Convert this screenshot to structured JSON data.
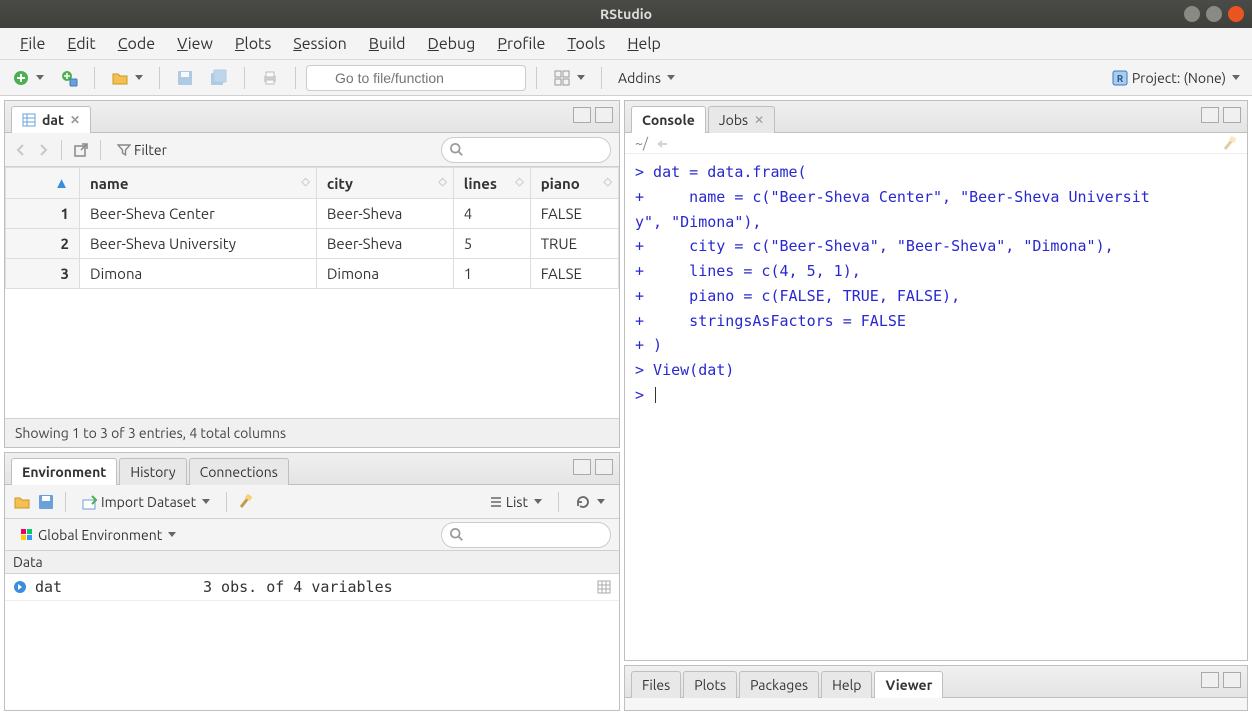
{
  "title": "RStudio",
  "menubar": [
    "File",
    "Edit",
    "Code",
    "View",
    "Plots",
    "Session",
    "Build",
    "Debug",
    "Profile",
    "Tools",
    "Help"
  ],
  "toolbar": {
    "goto_placeholder": "Go to file/function",
    "addins_label": "Addins",
    "project_label": "Project: (None)"
  },
  "source_pane": {
    "tab_label": "dat",
    "filter_label": "Filter",
    "columns": [
      "name",
      "city",
      "lines",
      "piano"
    ],
    "rows": [
      {
        "row": 1,
        "name": "Beer-Sheva Center",
        "city": "Beer-Sheva",
        "lines": "4",
        "piano": "FALSE"
      },
      {
        "row": 2,
        "name": "Beer-Sheva University",
        "city": "Beer-Sheva",
        "lines": "5",
        "piano": "TRUE"
      },
      {
        "row": 3,
        "name": "Dimona",
        "city": "Dimona",
        "lines": "1",
        "piano": "FALSE"
      }
    ],
    "footer": "Showing 1 to 3 of 3 entries, 4 total columns"
  },
  "env_pane": {
    "tabs": [
      "Environment",
      "History",
      "Connections"
    ],
    "import_label": "Import Dataset",
    "view_label": "List",
    "scope_label": "Global Environment",
    "section": "Data",
    "obj_name": "dat",
    "obj_desc": "3 obs. of  4 variables"
  },
  "console_pane": {
    "tabs": [
      "Console",
      "Jobs"
    ],
    "path": "~/",
    "text": "> dat = data.frame(\n+     name = c(\"Beer-Sheva Center\", \"Beer-Sheva Universit\ny\", \"Dimona\"),\n+     city = c(\"Beer-Sheva\", \"Beer-Sheva\", \"Dimona\"),\n+     lines = c(4, 5, 1),\n+     piano = c(FALSE, TRUE, FALSE),\n+     stringsAsFactors = FALSE\n+ )\n> View(dat)\n> "
  },
  "viewer_pane": {
    "tabs": [
      "Files",
      "Plots",
      "Packages",
      "Help",
      "Viewer"
    ]
  }
}
